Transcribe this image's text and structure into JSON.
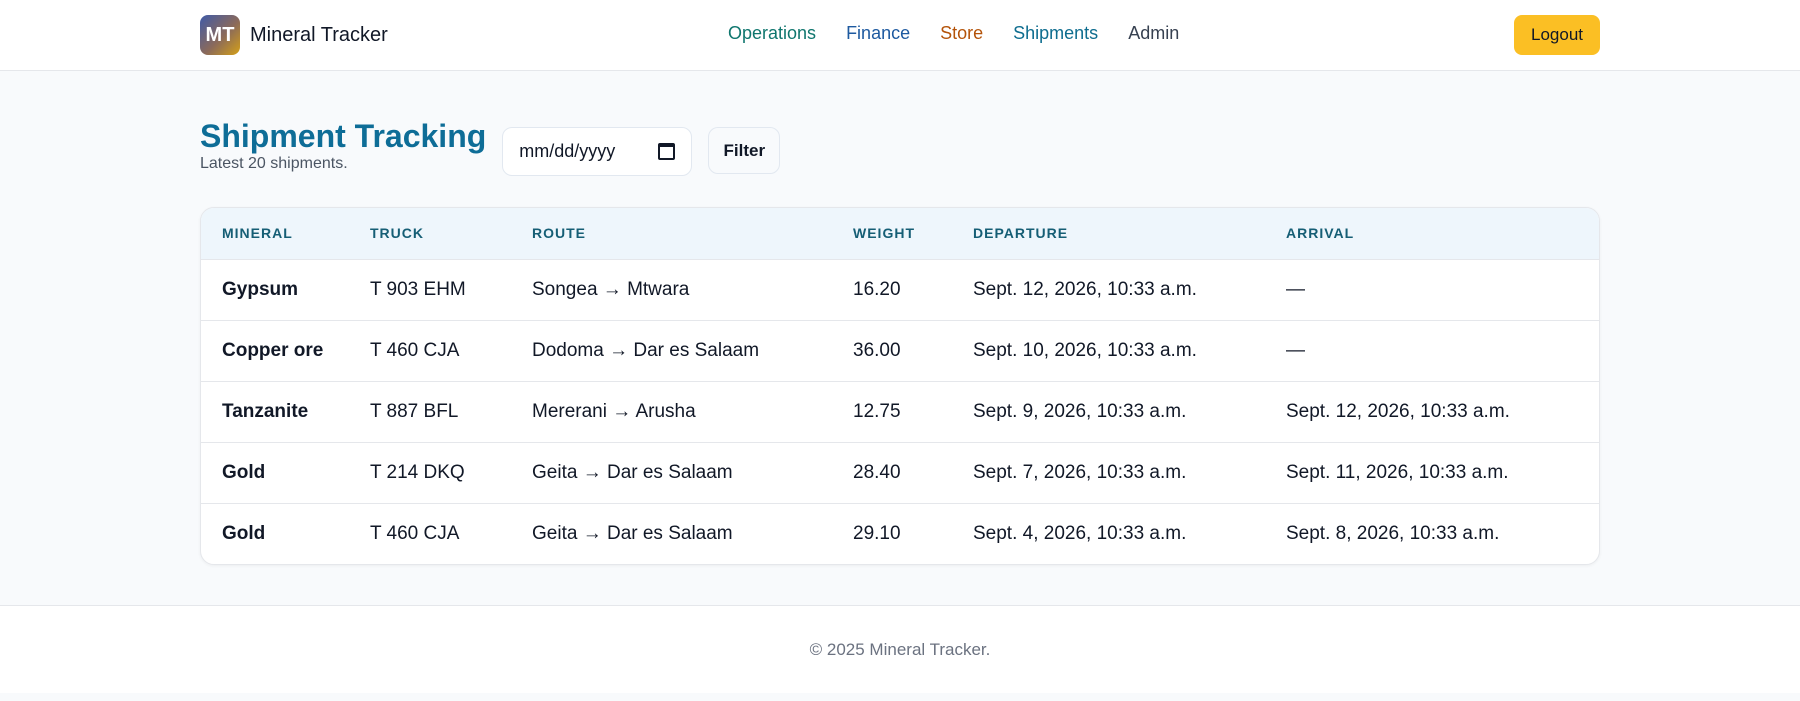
{
  "header": {
    "logo_text": "MT",
    "brand": "Mineral Tracker",
    "nav": [
      {
        "label": "Operations",
        "color": "#0f766e"
      },
      {
        "label": "Finance",
        "color": "#1e5aa0"
      },
      {
        "label": "Store",
        "color": "#b45309"
      },
      {
        "label": "Shipments",
        "color": "#0e6d8f"
      },
      {
        "label": "Admin",
        "color": "#374151"
      }
    ],
    "logout_label": "Logout"
  },
  "page": {
    "title": "Shipment Tracking",
    "subtitle": "Latest 20 shipments.",
    "date_placeholder": "mm/dd/yyyy",
    "filter_label": "Filter"
  },
  "table": {
    "columns": [
      "MINERAL",
      "TRUCK",
      "ROUTE",
      "WEIGHT",
      "DEPARTURE",
      "ARRIVAL"
    ],
    "rows": [
      [
        "Gypsum",
        "T 903 EHM",
        "Songea → Mtwara",
        "16.20",
        "Sept. 12, 2026, 10:33 a.m.",
        "—"
      ],
      [
        "Copper ore",
        "T 460 CJA",
        "Dodoma → Dar es Salaam",
        "36.00",
        "Sept. 10, 2026, 10:33 a.m.",
        "—"
      ],
      [
        "Tanzanite",
        "T 887 BFL",
        "Mererani → Arusha",
        "12.75",
        "Sept. 9, 2026, 10:33 a.m.",
        "Sept. 12, 2026, 10:33 a.m."
      ],
      [
        "Gold",
        "T 214 DKQ",
        "Geita → Dar es Salaam",
        "28.40",
        "Sept. 7, 2026, 10:33 a.m.",
        "Sept. 11, 2026, 10:33 a.m."
      ],
      [
        "Gold",
        "T 460 CJA",
        "Geita → Dar es Salaam",
        "29.10",
        "Sept. 4, 2026, 10:33 a.m.",
        "Sept. 8, 2026, 10:33 a.m."
      ]
    ]
  },
  "footer": {
    "text": "© 2025 Mineral Tracker."
  }
}
